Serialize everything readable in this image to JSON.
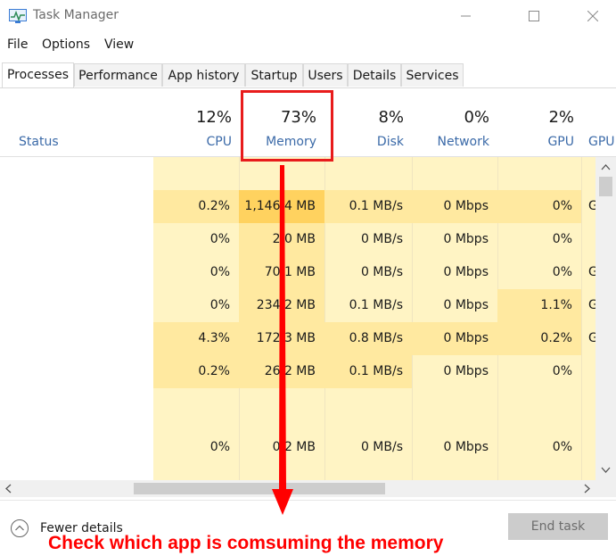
{
  "window": {
    "title": "Task Manager"
  },
  "menu": [
    "File",
    "Options",
    "View"
  ],
  "tabs": [
    "Processes",
    "Performance",
    "App history",
    "Startup",
    "Users",
    "Details",
    "Services"
  ],
  "columns": {
    "status": {
      "label": "Status"
    },
    "cpu": {
      "pct": "12%",
      "label": "CPU"
    },
    "memory": {
      "pct": "73%",
      "label": "Memory"
    },
    "disk": {
      "pct": "8%",
      "label": "Disk"
    },
    "network": {
      "pct": "0%",
      "label": "Network"
    },
    "gpu": {
      "pct": "2%",
      "label": "GPU"
    },
    "gpu_engine": {
      "label": "GPU"
    }
  },
  "rows": [
    {
      "cpu": "",
      "memory": "",
      "disk": "",
      "network": "",
      "gpu": "",
      "gpu_engine": ""
    },
    {
      "cpu": "0.2%",
      "memory": "1,146.4 MB",
      "disk": "0.1 MB/s",
      "network": "0 Mbps",
      "gpu": "0%",
      "gpu_engine": "G"
    },
    {
      "cpu": "0%",
      "memory": "2.0 MB",
      "disk": "0 MB/s",
      "network": "0 Mbps",
      "gpu": "0%",
      "gpu_engine": ""
    },
    {
      "cpu": "0%",
      "memory": "70.1 MB",
      "disk": "0 MB/s",
      "network": "0 Mbps",
      "gpu": "0%",
      "gpu_engine": "G"
    },
    {
      "cpu": "0%",
      "memory": "234.2 MB",
      "disk": "0.1 MB/s",
      "network": "0 Mbps",
      "gpu": "1.1%",
      "gpu_engine": "G"
    },
    {
      "cpu": "4.3%",
      "memory": "172.3 MB",
      "disk": "0.8 MB/s",
      "network": "0 Mbps",
      "gpu": "0.2%",
      "gpu_engine": "G"
    },
    {
      "cpu": "0.2%",
      "memory": "26.2 MB",
      "disk": "0.1 MB/s",
      "network": "0 Mbps",
      "gpu": "0%",
      "gpu_engine": ""
    },
    {
      "cpu": "",
      "memory": "",
      "disk": "",
      "network": "",
      "gpu": "",
      "gpu_engine": ""
    },
    {
      "cpu": "0%",
      "memory": "0.2 MB",
      "disk": "0 MB/s",
      "network": "0 Mbps",
      "gpu": "0%",
      "gpu_engine": ""
    }
  ],
  "footer": {
    "fewer_details": "Fewer details",
    "end_task": "End task"
  },
  "annotation": "Check which app is comsuming the memory",
  "colors": {
    "highlight": "#e81c1c",
    "annotation": "#ff0000",
    "heat_light": "#fff4c4",
    "heat_medium": "#ffe9a0",
    "heat_strong": "#ffd25f"
  }
}
